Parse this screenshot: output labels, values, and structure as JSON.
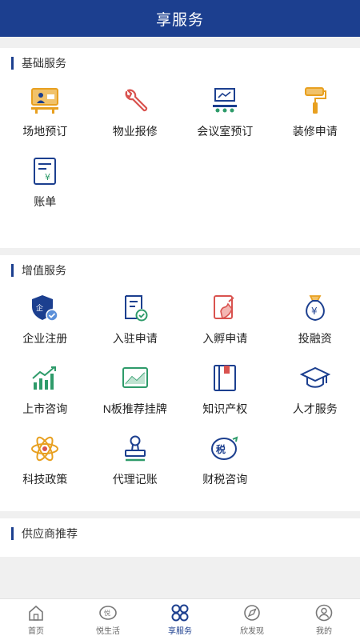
{
  "header": {
    "title": "享服务"
  },
  "basic": {
    "title": "基础服务",
    "items": [
      {
        "label": "场地预订",
        "icon": "venue-icon"
      },
      {
        "label": "物业报修",
        "icon": "wrench-icon"
      },
      {
        "label": "会议室预订",
        "icon": "meeting-room-icon"
      },
      {
        "label": "装修申请",
        "icon": "paint-roller-icon"
      },
      {
        "label": "账单",
        "icon": "bill-icon"
      }
    ]
  },
  "value_added": {
    "title": "增值服务",
    "items": [
      {
        "label": "企业注册",
        "icon": "company-register-icon"
      },
      {
        "label": "入驻申请",
        "icon": "settle-in-icon"
      },
      {
        "label": "入孵申请",
        "icon": "incubate-icon"
      },
      {
        "label": "投融资",
        "icon": "money-bag-icon"
      },
      {
        "label": "上市咨询",
        "icon": "listing-chart-icon"
      },
      {
        "label": "N板推荐挂牌",
        "icon": "n-board-icon"
      },
      {
        "label": "知识产权",
        "icon": "intellectual-property-icon"
      },
      {
        "label": "人才服务",
        "icon": "graduation-cap-icon"
      },
      {
        "label": "科技政策",
        "icon": "atom-icon"
      },
      {
        "label": "代理记账",
        "icon": "stamp-icon"
      },
      {
        "label": "财税咨询",
        "icon": "tax-icon"
      }
    ]
  },
  "supplier": {
    "title": "供应商推荐"
  },
  "nav": {
    "items": [
      {
        "label": "首页",
        "icon": "home-icon"
      },
      {
        "label": "悦生活",
        "icon": "life-icon"
      },
      {
        "label": "享服务",
        "icon": "service-icon"
      },
      {
        "label": "欣发现",
        "icon": "discover-icon"
      },
      {
        "label": "我的",
        "icon": "user-icon"
      }
    ],
    "active_index": 2
  },
  "colors": {
    "primary": "#1c3f8f",
    "accent_orange": "#e8a020",
    "accent_green": "#2e9b6a",
    "accent_red": "#d9534f"
  }
}
